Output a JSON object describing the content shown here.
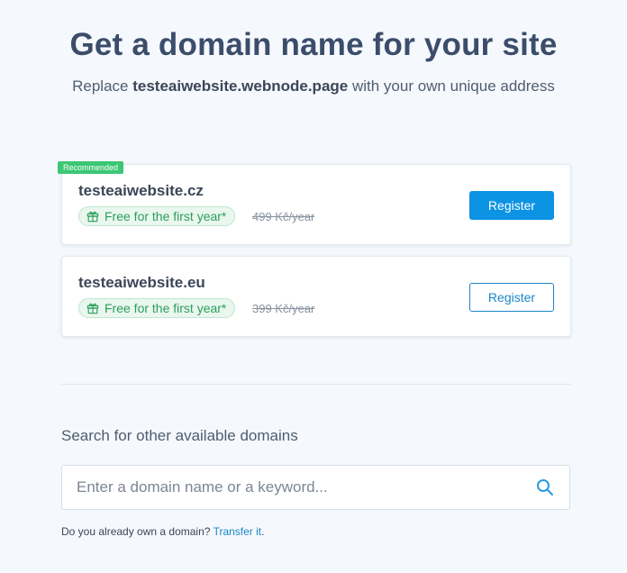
{
  "header": {
    "title": "Get a domain name for your site",
    "subtitle_prefix": "Replace ",
    "current_address": "testeaiwebsite.webnode.page",
    "subtitle_suffix": " with your own unique address"
  },
  "offers": [
    {
      "ribbon": "Recommended",
      "domain": "testeaiwebsite.cz",
      "badge": "Free for the first year*",
      "old_price": "499 Kč/year",
      "button": "Register"
    },
    {
      "domain": "testeaiwebsite.eu",
      "badge": "Free for the first year*",
      "old_price": "399 Kč/year",
      "button": "Register"
    }
  ],
  "search": {
    "label": "Search for other available domains",
    "placeholder": "Enter a domain name or a keyword..."
  },
  "footer": {
    "question": "Do you already own a domain? ",
    "link": "Transfer it",
    "suffix": "."
  },
  "colors": {
    "accent": "#0c93e4",
    "recommended": "#3cc774",
    "free_badge_text": "#2c9e5a"
  },
  "icons": [
    "gift-icon",
    "search-icon"
  ]
}
